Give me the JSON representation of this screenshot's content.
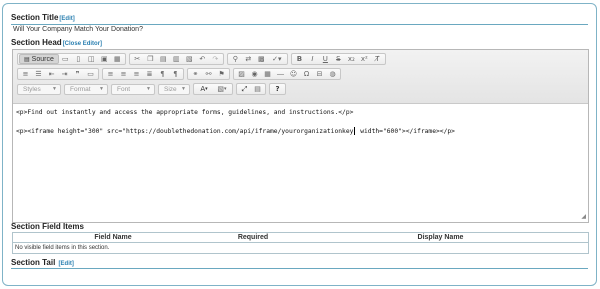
{
  "section_title": {
    "label": "Section Title",
    "edit_link": "[Edit]",
    "value": "Will Your Company Match Your Donation?"
  },
  "section_head": {
    "label": "Section Head",
    "close_link": "[Close Editor]"
  },
  "toolbar": {
    "source_label": "Source",
    "row1_icons": [
      "save-icon",
      "new-page-icon",
      "preview-icon",
      "print-icon",
      "templates-icon",
      "cut-icon",
      "copy-icon",
      "paste-icon",
      "paste-text-icon",
      "paste-word-icon",
      "undo-icon",
      "redo-icon",
      "find-icon",
      "replace-icon",
      "select-all-icon",
      "spellcheck-icon",
      "bold-icon",
      "italic-icon",
      "underline-icon",
      "strike-icon",
      "subscript-icon",
      "superscript-icon",
      "remove-format-icon"
    ],
    "row1_glyphs": {
      "bold": "B",
      "italic": "I",
      "underline": "U",
      "strike": "S",
      "subscript": "x₂",
      "superscript": "x²",
      "remove": "Tx"
    },
    "combos": {
      "styles": "Styles",
      "format": "Format",
      "font": "Font",
      "size": "Size"
    },
    "color_label": "A",
    "help_label": "?"
  },
  "editor": {
    "line1": "<p>Find out instantly and access the appropriate forms, guidelines, and instructions.</p>",
    "line2_before_caret": "<p><iframe height=\"300\" src=\"https://doublethedonation.com/api/iframe/yourorganizationkey",
    "line2_after_caret": " width=\"600\"></iframe></p>"
  },
  "section_field_items": {
    "label": "Section Field Items",
    "columns": [
      "Field Name",
      "Required",
      "Display Name"
    ],
    "empty_text": "No visible field items in this section."
  },
  "section_tail": {
    "label": "Section Tail",
    "edit_link": "[Edit]"
  }
}
